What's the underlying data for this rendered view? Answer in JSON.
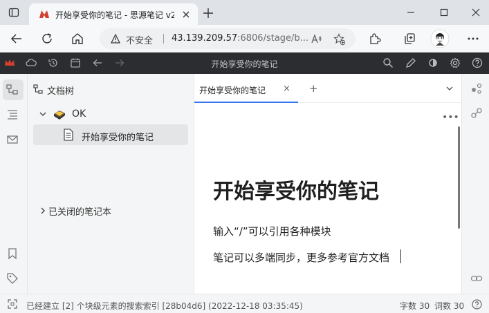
{
  "browser": {
    "tab_title": "开始享受你的笔记 - 思源笔记 v2.",
    "security_label": "不安全",
    "url_host": "43.139.209.57",
    "url_rest": ":6806/stage/b..."
  },
  "app_toolbar": {
    "title": "开始享受你的笔记"
  },
  "filetree": {
    "header": "文档树",
    "notebook": "OK",
    "document": "开始享受你的笔记",
    "closed_notebooks": "已关闭的笔记本"
  },
  "editor": {
    "tab_label": "开始享受你的笔记",
    "tab_close": "×",
    "tab_add": "+",
    "more": "•••",
    "title": "开始享受你的笔记",
    "paragraphs": [
      "输入“/”可以引用各种模块",
      "笔记可以多端同步，更多参考官方文档"
    ]
  },
  "status": {
    "message": "已经建立 [2] 个块级元素的搜索索引 [28b04d6] (2022-12-18 03:35:45)",
    "char_count": "字数 30",
    "word_count": "词数 30"
  },
  "colors": {
    "accent": "#3575f0",
    "toolbar_bg": "#2b2d30",
    "brand_red": "#d23f31"
  }
}
